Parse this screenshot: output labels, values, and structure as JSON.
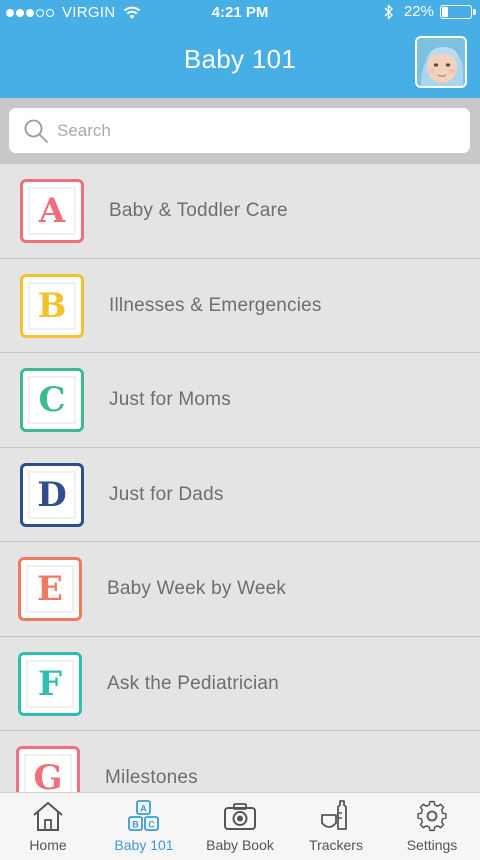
{
  "status_bar": {
    "carrier": "VIRGIN",
    "signal_full": 3,
    "signal_total": 5,
    "time": "4:21 PM",
    "battery_percent": "22%",
    "battery_level": 0.22
  },
  "header": {
    "title": "Baby 101",
    "avatar_icon": "baby-photo-avatar"
  },
  "search": {
    "placeholder": "Search",
    "value": ""
  },
  "topics": [
    {
      "letter": "A",
      "label": "Baby & Toddler Care",
      "color": "#ef6f7d"
    },
    {
      "letter": "B",
      "label": "Illnesses & Emergencies",
      "color": "#f2c12e"
    },
    {
      "letter": "C",
      "label": "Just for Moms",
      "color": "#3dbb8e"
    },
    {
      "letter": "D",
      "label": "Just for Dads",
      "color": "#2f4e8f"
    },
    {
      "letter": "E",
      "label": "Baby Week by Week",
      "color": "#f07a5f"
    },
    {
      "letter": "F",
      "label": "Ask the Pediatrician",
      "color": "#2fbfb0"
    },
    {
      "letter": "G",
      "label": "Milestones",
      "color": "#ef6f7d"
    }
  ],
  "tabbar": {
    "active_color": "#3a9ad9",
    "tabs": [
      {
        "label": "Home",
        "icon": "home-icon"
      },
      {
        "label": "Baby 101",
        "icon": "abc-blocks-icon"
      },
      {
        "label": "Baby Book",
        "icon": "camera-icon"
      },
      {
        "label": "Trackers",
        "icon": "bottle-diaper-icon"
      },
      {
        "label": "Settings",
        "icon": "gear-icon"
      }
    ]
  },
  "colors": {
    "header": "#48aee6",
    "list_bg": "#e4e4e4",
    "search_bar_bg": "#c8c8c8"
  }
}
